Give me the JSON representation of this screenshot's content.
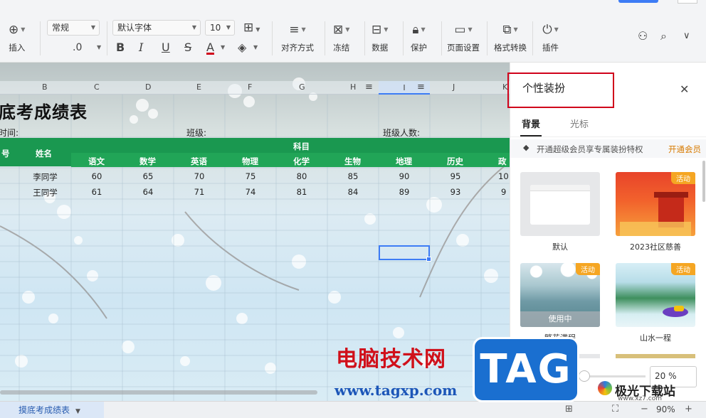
{
  "ribbon": {
    "insert_label": "插入",
    "number_format": "常规",
    "decimal": ".0",
    "font_name": "默认字体",
    "font_size": "10",
    "align_label": "对齐方式",
    "freeze_label": "冻结",
    "data_label": "数据",
    "protect_label": "保护",
    "page_setup_label": "页面设置",
    "format_convert_label": "格式转换",
    "plugin_label": "插件"
  },
  "sheet": {
    "columns": [
      "B",
      "C",
      "D",
      "E",
      "F",
      "G",
      "H",
      "I",
      "J",
      "K"
    ],
    "title": "底考成绩表",
    "time_label": "时间:",
    "class_label": "班级:",
    "class_count_label": "班级人数:",
    "seq_header": "号",
    "name_header": "姓名",
    "subject_header": "科目",
    "subjects": [
      "语文",
      "数学",
      "英语",
      "物理",
      "化学",
      "生物",
      "地理",
      "历史",
      "政"
    ],
    "rows": [
      {
        "name": "李同学",
        "scores": [
          "60",
          "65",
          "70",
          "75",
          "80",
          "85",
          "90",
          "95",
          "10"
        ]
      },
      {
        "name": "王同学",
        "scores": [
          "61",
          "64",
          "71",
          "74",
          "81",
          "84",
          "89",
          "93",
          "9"
        ]
      }
    ]
  },
  "status": {
    "sheet_tab": "摸底考成绩表",
    "zoom": "90%"
  },
  "panel": {
    "title": "个性装扮",
    "tabs": [
      "背景",
      "光标"
    ],
    "promo_text": "开通超级会员享专属装扮特权",
    "promo_link": "开通会员",
    "cards": [
      {
        "label": "默认",
        "badge": ""
      },
      {
        "label": "2023社区慈善",
        "badge": "活动"
      },
      {
        "label": "繁花满程",
        "badge": "活动",
        "status": "使用中"
      },
      {
        "label": "山水一程",
        "badge": "活动"
      }
    ],
    "opacity": "20 %"
  },
  "watermark": {
    "title": "电脑技术网",
    "url": "www.tagxp.com",
    "tag": "TAG",
    "site_name": "极光下载站",
    "site_url": "www.xz7.com"
  }
}
